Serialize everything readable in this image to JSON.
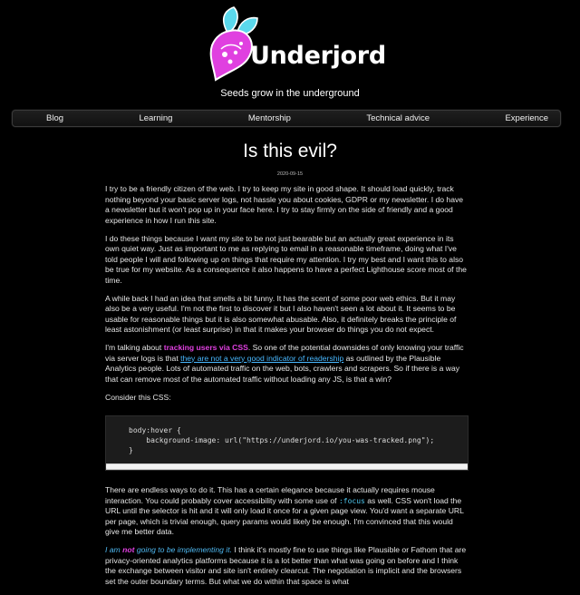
{
  "site": {
    "name": "Underjord",
    "tagline": "Seeds grow in the underground",
    "logo_icon": "beet-icon",
    "colors": {
      "brand_pink": "#e040e0",
      "brand_cyan": "#4fd0f0"
    }
  },
  "nav": {
    "items": [
      {
        "label": "Blog"
      },
      {
        "label": "Learning"
      },
      {
        "label": "Mentorship"
      },
      {
        "label": "Technical advice"
      },
      {
        "label": "Experience"
      }
    ]
  },
  "article": {
    "title": "Is this evil?",
    "date": "2020-09-15",
    "p1": "I try to be a friendly citizen of the web. I try to keep my site in good shape. It should load quickly, track nothing beyond your basic server logs, not hassle you about cookies, GDPR or my newsletter. I do have a newsletter but it won't pop up in your face here. I try to stay firmly on the side of friendly and a good experience in how I run this site.",
    "p2": "I do these things because I want my site to be not just bearable but an actually great experience in its own quiet way. Just as important to me as replying to email in a reasonable timeframe, doing what I've told people I will and following up on things that require my attention. I try my best and I want this to also be true for my website. As a consequence it also happens to have a perfect Lighthouse score most of the time.",
    "p3": "A while back I had an idea that smells a bit funny. It has the scent of some poor web ethics. But it may also be a very useful. I'm not the first to discover it but I also haven't seen a lot about it. It seems to be usable for reasonable things but it is also somewhat abusable. Also, it definitely breaks the principle of least astonishment (or least surprise) in that it makes your browser do things you do not expect.",
    "p4": {
      "before_highlight": "I'm talking about ",
      "highlight": "tracking users via CSS",
      "after_highlight": ". So one of the potential downsides of only knowing your traffic via server logs is that ",
      "link": "they are not a very good indicator of readership",
      "after_link": " as outlined by the Plausible Analytics people. Lots of automated traffic on the web, bots, crawlers and scrapers. So if there is a way that can remove most of the automated traffic without loading any JS, is that a win?"
    },
    "p5": "Consider this CSS:",
    "code": "body:hover {\n    background-image: url(\"https://underjord.io/you-was-tracked.png\");\n}",
    "p6": {
      "before_code": "There are endless ways to do it. This has a certain elegance because it actually requires mouse interaction. You could probably cover accessibility with some use of ",
      "code": ":focus",
      "after_code": " as well. CSS won't load the URL until the selector is hit and it will only load it once for a given page view. You'd want a separate URL per page, which is trivial enough, query params would likely be enough. I'm convinced that this would give me better data."
    },
    "p7": {
      "lead_1": "I am ",
      "lead_not": "not",
      "lead_2": " going to be implementing it.",
      "rest": " I think it's mostly fine to use things like Plausible or Fathom that are privacy-oriented analytics platforms because it is a lot better than what was going on before and I think the exchange between visitor and site isn't entirely clearcut. The negotiation is implicit and the browsers set the outer boundary terms. But what we do within that space is what"
    }
  }
}
